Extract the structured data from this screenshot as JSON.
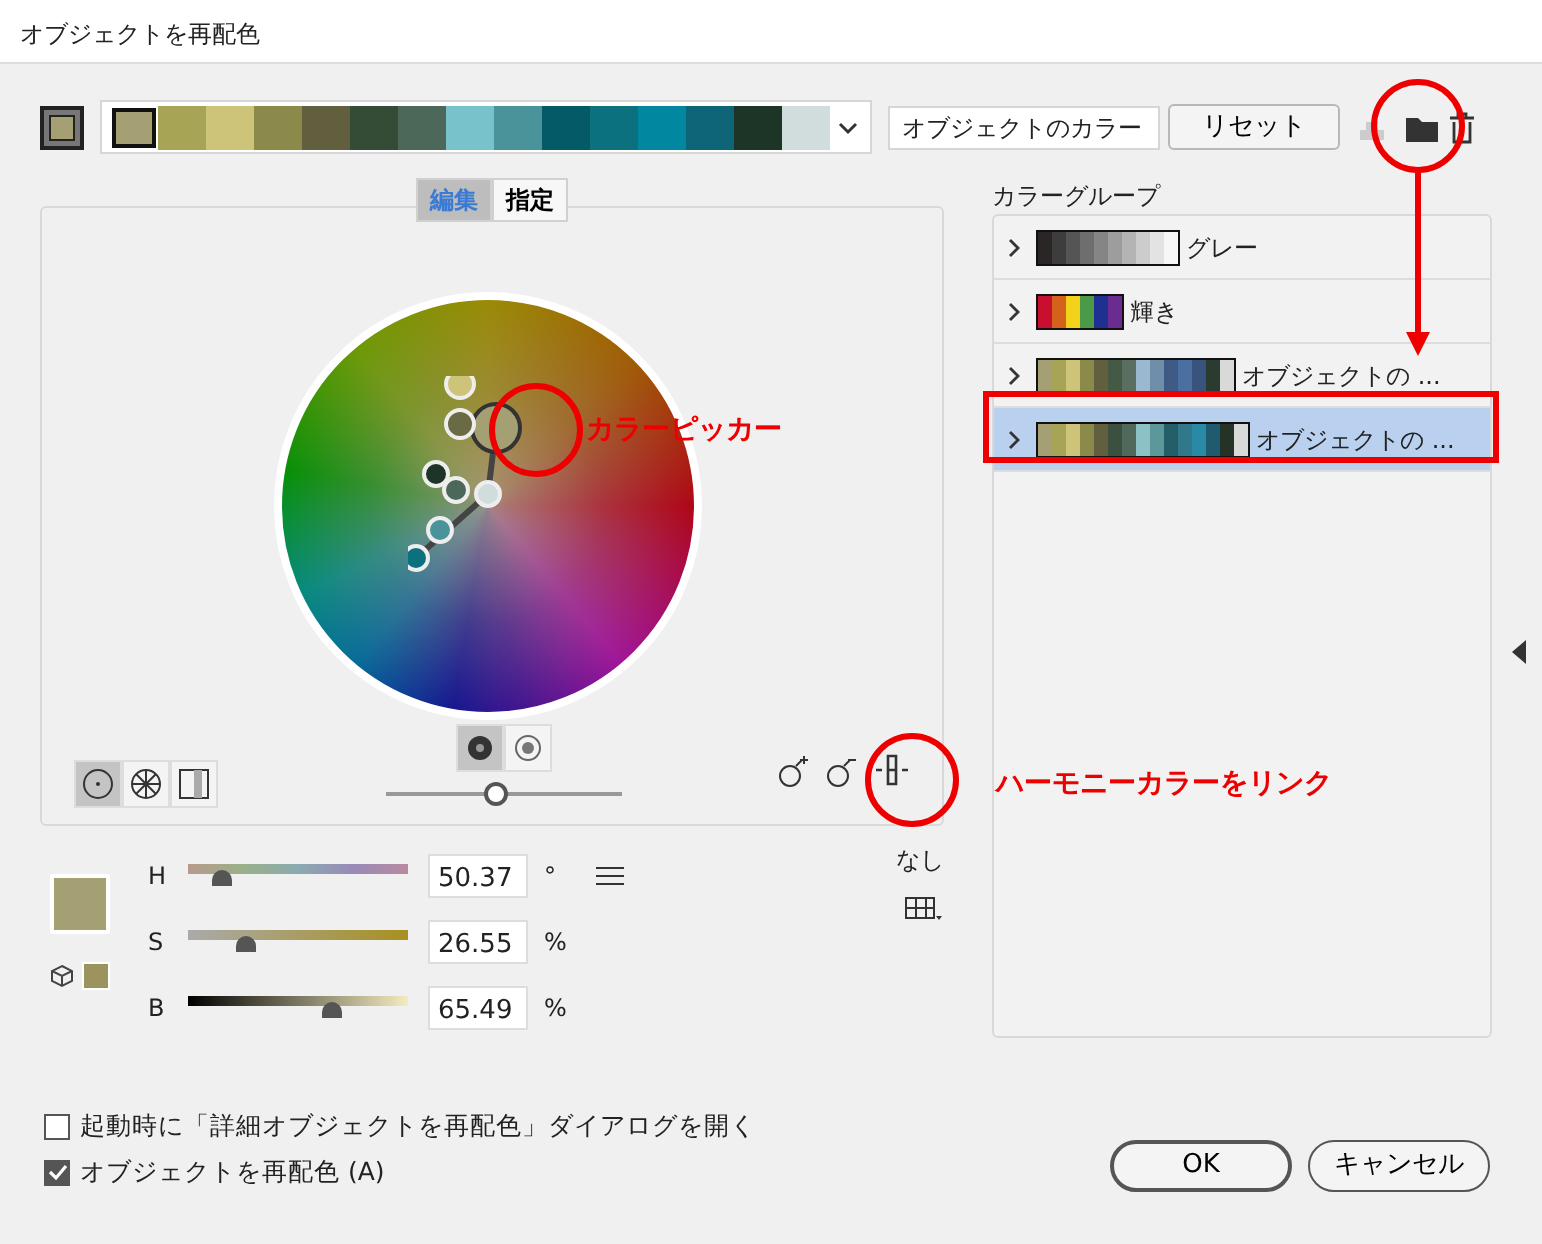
{
  "window": {
    "title": "オブジェクトを再配色"
  },
  "top_bar": {
    "swatches": [
      {
        "color": "#a59f74",
        "selected": true
      },
      {
        "color": "#a8a456",
        "selected": false
      },
      {
        "color": "#cdc47a",
        "selected": false
      },
      {
        "color": "#8c8a4b",
        "selected": false
      },
      {
        "color": "#615f3e",
        "selected": false
      },
      {
        "color": "#344c35",
        "selected": false
      },
      {
        "color": "#4b6858",
        "selected": false
      },
      {
        "color": "#78c3cb",
        "selected": false
      },
      {
        "color": "#4a939b",
        "selected": false
      },
      {
        "color": "#045b67",
        "selected": false
      },
      {
        "color": "#0b717f",
        "selected": false
      },
      {
        "color": "#0287a0",
        "selected": false
      },
      {
        "color": "#0e6577",
        "selected": false
      },
      {
        "color": "#1c3526",
        "selected": false
      },
      {
        "color": "#d1dcdc",
        "selected": false
      }
    ],
    "name_field": "オブジェクトのカラー",
    "reset_button": "リセット"
  },
  "tabs": [
    {
      "label": "編集",
      "selected": true
    },
    {
      "label": "指定",
      "selected": false
    }
  ],
  "wheel_modes": [
    {
      "kind": "smooth",
      "selected": true
    },
    {
      "kind": "segmented",
      "selected": false
    },
    {
      "kind": "bars",
      "selected": false
    }
  ],
  "wheel_display": [
    {
      "kind": "brightness",
      "selected": true
    },
    {
      "kind": "saturation",
      "selected": false
    }
  ],
  "wheel_slider": {
    "level": 0.47
  },
  "harmony_link": {
    "label": "なし"
  },
  "hsb": [
    {
      "label": "H",
      "value": "50.37",
      "unit": "°",
      "level": 0.15,
      "kind": "hue"
    },
    {
      "label": "S",
      "value": "26.55",
      "unit": "%",
      "level": 0.26,
      "kind": "sat"
    },
    {
      "label": "B",
      "value": "65.49",
      "unit": "%",
      "level": 0.65,
      "kind": "bri"
    }
  ],
  "color_groups": {
    "title": "カラーグループ",
    "items": [
      {
        "name": "グレー",
        "selected": false,
        "colors": [
          {
            "color": "#2a2626"
          },
          {
            "color": "#3d3d3d"
          },
          {
            "color": "#555555"
          },
          {
            "color": "#6e6e6e"
          },
          {
            "color": "#858585"
          },
          {
            "color": "#9d9d9d"
          },
          {
            "color": "#b4b4b4"
          },
          {
            "color": "#cccccc"
          },
          {
            "color": "#e3e3e3"
          },
          {
            "color": "#f7f7f7"
          }
        ]
      },
      {
        "name": "輝き",
        "selected": false,
        "colors": [
          {
            "color": "#c8102e"
          },
          {
            "color": "#d4621a"
          },
          {
            "color": "#f3d21c"
          },
          {
            "color": "#4a9a4a"
          },
          {
            "color": "#1f3190"
          },
          {
            "color": "#6a2c91"
          }
        ]
      },
      {
        "name": "オブジェクトの ...",
        "selected": false,
        "colors": [
          {
            "color": "#a59f74"
          },
          {
            "color": "#a8a456"
          },
          {
            "color": "#cdc47a"
          },
          {
            "color": "#8c8a4b"
          },
          {
            "color": "#615f3e"
          },
          {
            "color": "#445a44"
          },
          {
            "color": "#5a6e62"
          },
          {
            "color": "#9ab8cf"
          },
          {
            "color": "#6f8ea9"
          },
          {
            "color": "#3e5a86"
          },
          {
            "color": "#4b6fa0"
          },
          {
            "color": "#38547e"
          },
          {
            "color": "#2b3b30"
          },
          {
            "color": "#d9d9d9"
          }
        ]
      },
      {
        "name": "オブジェクトの ...",
        "selected": true,
        "colors": [
          {
            "color": "#a59f74"
          },
          {
            "color": "#a8a456"
          },
          {
            "color": "#cdc47a"
          },
          {
            "color": "#8c8a4b"
          },
          {
            "color": "#615f3e"
          },
          {
            "color": "#3b503e"
          },
          {
            "color": "#4f6a5a"
          },
          {
            "color": "#8cc2c6"
          },
          {
            "color": "#5c979a"
          },
          {
            "color": "#245f69"
          },
          {
            "color": "#30788a"
          },
          {
            "color": "#2a8aa6"
          },
          {
            "color": "#1f5a6e"
          },
          {
            "color": "#253226"
          },
          {
            "color": "#d9d9d9"
          }
        ]
      }
    ]
  },
  "options": [
    {
      "label": "起動時に「詳細オブジェクトを再配色」ダイアログを開く",
      "checked": false
    },
    {
      "label": "オブジェクトを再配色 (A)",
      "checked": true
    }
  ],
  "buttons": [
    "OK",
    "キャンセル"
  ],
  "annotations": [
    "カラーピッカー",
    "ハーモニーカラーをリンク"
  ]
}
